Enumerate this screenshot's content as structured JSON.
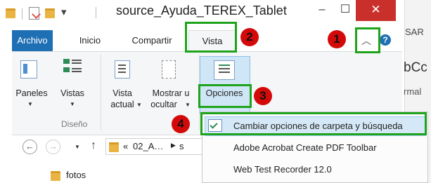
{
  "window": {
    "title": "source_Ayuda_TEREX_Tablet",
    "minimize": "–",
    "maximize": "☐",
    "close": "✕",
    "right_partial": [
      "SAR",
      "bCc",
      "rmal"
    ]
  },
  "tabs": [
    {
      "label": "Archivo"
    },
    {
      "label": "Inicio"
    },
    {
      "label": "Compartir"
    },
    {
      "label": "Vista"
    }
  ],
  "ribbon": {
    "paneles": "Paneles",
    "vistas": "Vistas",
    "diseno": "Diseño",
    "vista_actual_1": "Vista",
    "vista_actual_2": "actual",
    "mostrar_1": "Mostrar u",
    "mostrar_2": "ocultar",
    "opciones": "Opciones"
  },
  "address": {
    "crumb_prefix": "«",
    "crumb": "02_A…",
    "next": "s",
    "folder_item": "fotos"
  },
  "menu": {
    "items": [
      {
        "label": "Cambiar opciones de carpeta y búsqueda"
      },
      {
        "label": "Adobe Acrobat Create PDF Toolbar"
      },
      {
        "label": "Web Test Recorder 12.0"
      }
    ]
  },
  "callouts": [
    "1",
    "2",
    "3",
    "4"
  ],
  "colors": {
    "accent": "#1f6fb5",
    "highlight": "#1ea31b",
    "callout": "#d40a0a",
    "close": "#c9302c"
  },
  "icons": [
    "folder-icon",
    "page-icon",
    "chevron-up-icon",
    "help-icon",
    "back-icon",
    "forward-icon",
    "up-arrow-icon"
  ]
}
